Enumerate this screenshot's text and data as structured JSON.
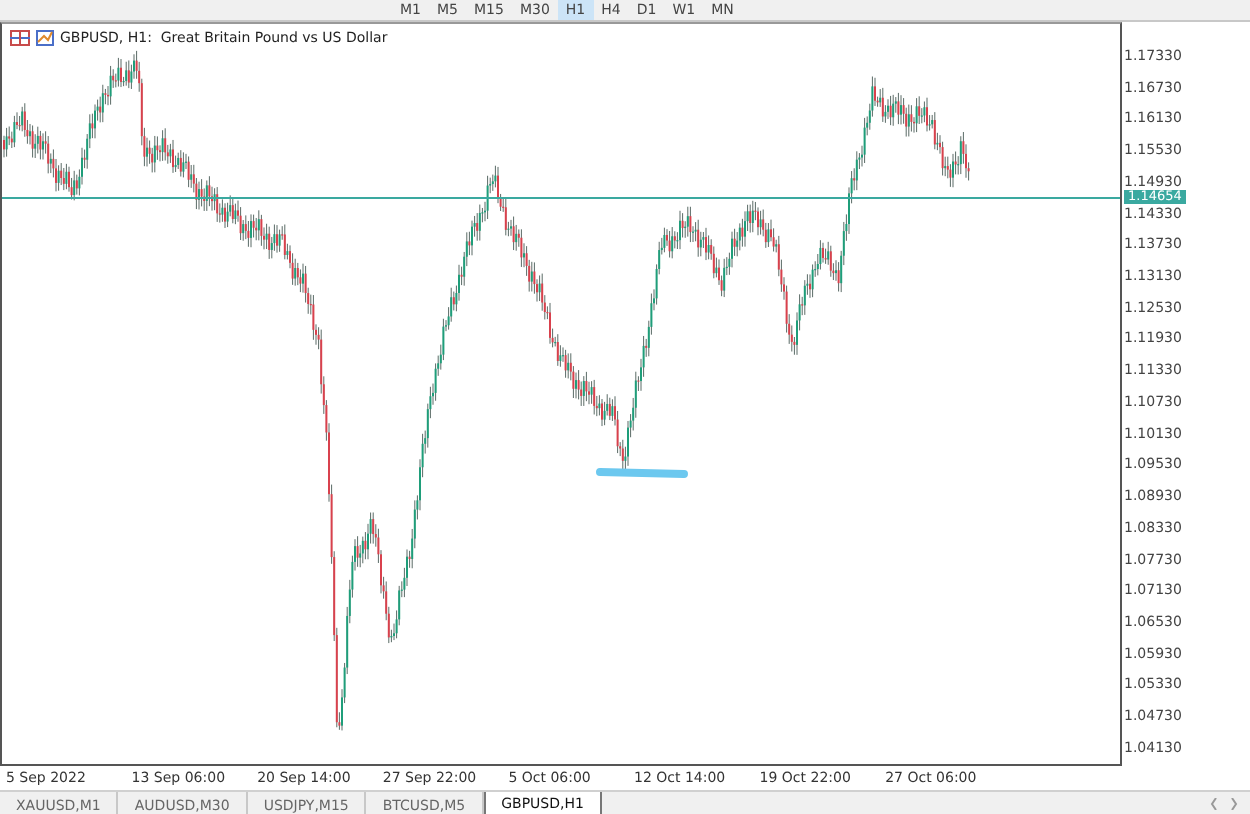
{
  "toolbar": {
    "timeframes": [
      {
        "label": "M1",
        "selected": false
      },
      {
        "label": "M5",
        "selected": false
      },
      {
        "label": "M15",
        "selected": false
      },
      {
        "label": "M30",
        "selected": false
      },
      {
        "label": "H1",
        "selected": true
      },
      {
        "label": "H4",
        "selected": false
      },
      {
        "label": "D1",
        "selected": false
      },
      {
        "label": "W1",
        "selected": false
      },
      {
        "label": "MN",
        "selected": false
      }
    ]
  },
  "chart": {
    "title": "GBPUSD, H1:  Great Britain Pound vs US Dollar",
    "current_price": "1.14654",
    "price_labels": [
      "1.17330",
      "1.16730",
      "1.16130",
      "1.15530",
      "1.14930",
      "1.14330",
      "1.13730",
      "1.13130",
      "1.12530",
      "1.11930",
      "1.11330",
      "1.10730",
      "1.10130",
      "1.09530",
      "1.08930",
      "1.08330",
      "1.07730",
      "1.07130",
      "1.06530",
      "1.05930",
      "1.05330",
      "1.04730",
      "1.04130"
    ],
    "time_labels": [
      "5 Sep 2022",
      "13 Sep 06:00",
      "20 Sep 14:00",
      "27 Sep 22:00",
      "5 Oct 06:00",
      "12 Oct 14:00",
      "19 Oct 22:00",
      "27 Oct 06:00"
    ]
  },
  "tabs": [
    {
      "label": "XAUUSD,M1",
      "selected": false
    },
    {
      "label": "AUDUSD,M30",
      "selected": false
    },
    {
      "label": "USDJPY,M15",
      "selected": false
    },
    {
      "label": "BTCUSD,M5",
      "selected": false
    },
    {
      "label": "GBPUSD,H1",
      "selected": true
    }
  ]
}
